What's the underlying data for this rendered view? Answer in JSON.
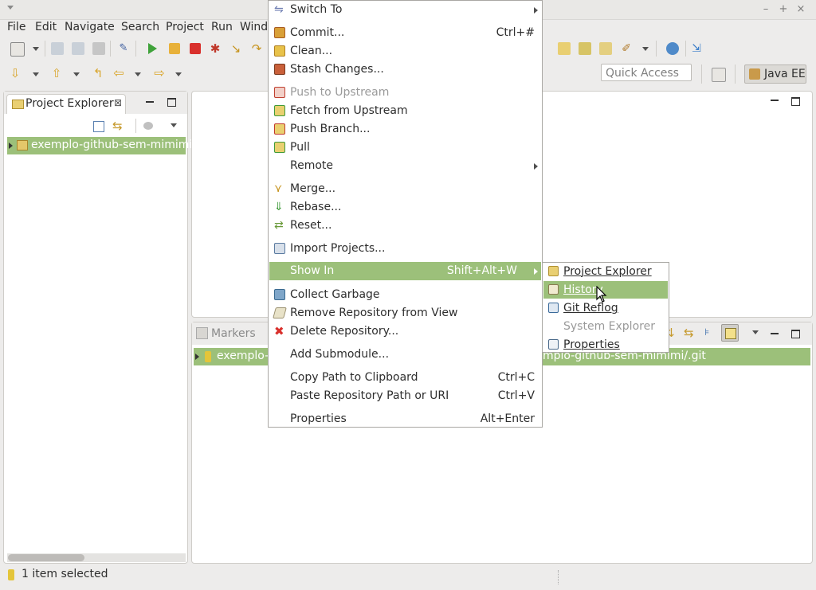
{
  "menubar": {
    "items": [
      "File",
      "Edit",
      "Navigate",
      "Search",
      "Project",
      "Run",
      "Windo"
    ]
  },
  "toolbar": {
    "quick_access_placeholder": "Quick Access",
    "perspective_label": "Java EE"
  },
  "project_explorer": {
    "tab_label": "Project Explorer",
    "tab_close": "⊠",
    "tree_items": [
      {
        "label": "exemplo-github-sem-mimimi"
      }
    ]
  },
  "bottom_panel": {
    "tab_label": "Markers",
    "row_label_left": "exemplo-g",
    "row_label_right": "mplo-github-sem-mimimi/.git"
  },
  "context_menu": {
    "items": [
      {
        "label": "Switch To",
        "submenu": true,
        "icon": "switch-icon"
      },
      {
        "label": "Commit...",
        "accel": "Ctrl+#",
        "icon": "commit-icon"
      },
      {
        "label": "Clean...",
        "icon": "clean-icon"
      },
      {
        "label": "Stash Changes...",
        "icon": "stash-icon"
      },
      {
        "label": "Push to Upstream",
        "disabled": true,
        "icon": "push-upstream-icon"
      },
      {
        "label": "Fetch from Upstream",
        "icon": "fetch-upstream-icon"
      },
      {
        "label": "Push Branch...",
        "icon": "push-branch-icon"
      },
      {
        "label": "Pull",
        "icon": "pull-icon"
      },
      {
        "label": "Remote",
        "submenu": true
      },
      {
        "label": "Merge...",
        "icon": "merge-icon"
      },
      {
        "label": "Rebase...",
        "icon": "rebase-icon"
      },
      {
        "label": "Reset...",
        "icon": "reset-icon"
      },
      {
        "label": "Import Projects...",
        "icon": "import-projects-icon"
      },
      {
        "label": "Show In",
        "accel": "Shift+Alt+W",
        "submenu": true,
        "selected": true
      },
      {
        "label": "Collect Garbage",
        "icon": "trash-icon"
      },
      {
        "label": "Remove Repository from View",
        "icon": "eraser-icon"
      },
      {
        "label": "Delete Repository...",
        "icon": "delete-icon"
      },
      {
        "label": "Add Submodule..."
      },
      {
        "label": "Copy Path to Clipboard",
        "accel": "Ctrl+C"
      },
      {
        "label": "Paste Repository Path or URI",
        "accel": "Ctrl+V"
      },
      {
        "label": "Properties",
        "accel": "Alt+Enter"
      }
    ]
  },
  "show_in_submenu": {
    "items": [
      {
        "label": "Project Explorer",
        "icon": "folder-icon"
      },
      {
        "label": "History",
        "icon": "history-icon",
        "selected": true
      },
      {
        "label": "Git Reflog",
        "icon": "reflog-icon"
      },
      {
        "label": "System Explorer",
        "disabled": true
      },
      {
        "label": "Properties",
        "icon": "properties-icon"
      }
    ]
  },
  "statusbar": {
    "text": "1 item selected"
  },
  "colors": {
    "selection": "#9cc07a",
    "background": "#edeceb"
  }
}
